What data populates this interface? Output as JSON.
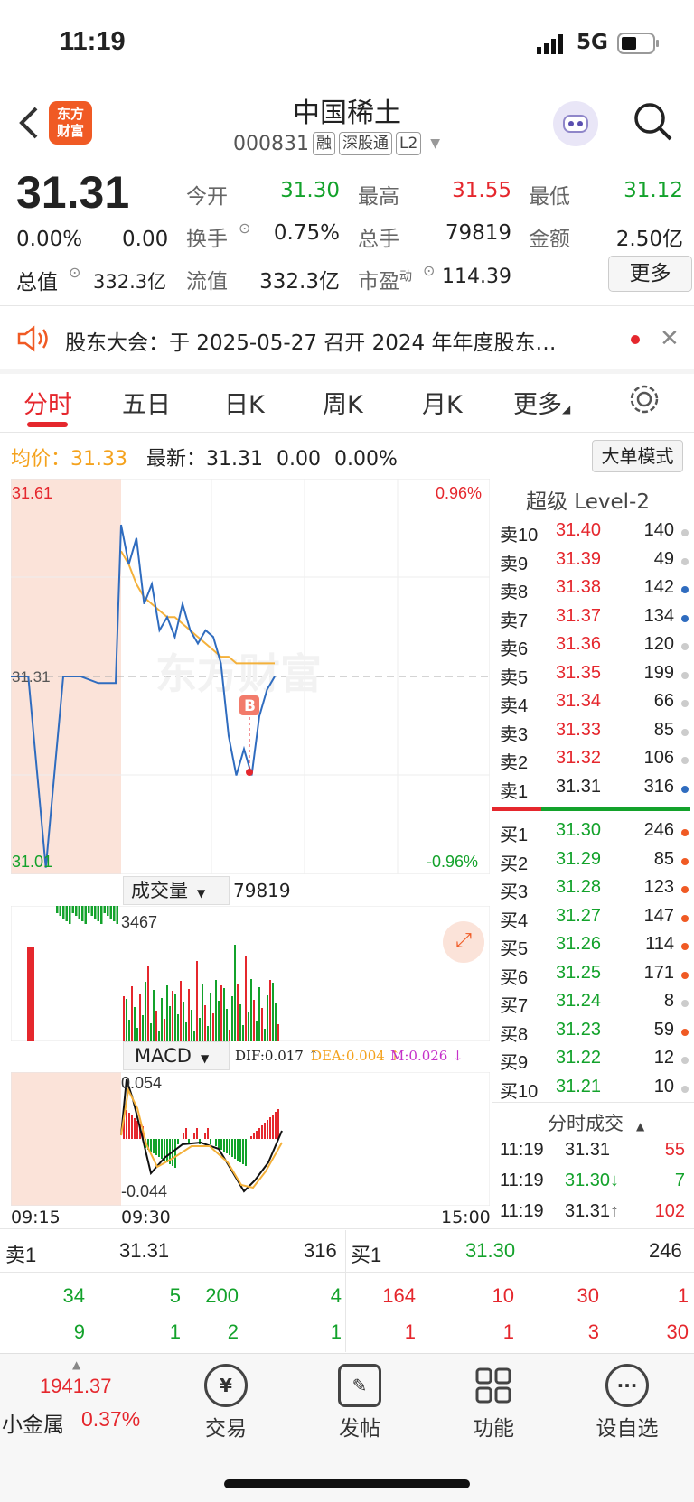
{
  "status_bar": {
    "time": "11:19",
    "network": "5G"
  },
  "header": {
    "logo_line1": "东方",
    "logo_line2": "财富",
    "title": "中国稀土",
    "code": "000831",
    "tags": [
      "融",
      "深股通",
      "L2"
    ]
  },
  "quote": {
    "price": "31.31",
    "change_pct": "0.00%",
    "change": "0.00",
    "open_label": "今开",
    "open": "31.30",
    "high_label": "最高",
    "high": "31.55",
    "low_label": "最低",
    "low": "31.12",
    "turnover_label": "换手",
    "turnover": "0.75%",
    "volume_label": "总手",
    "volume": "79819",
    "amount_label": "金额",
    "amount": "2.50亿",
    "mcap_label": "总值",
    "mcap": "332.3亿",
    "float_label": "流值",
    "float": "332.3亿",
    "pe_label": "市盈",
    "pe_sup": "动",
    "pe": "114.39",
    "more_label": "更多"
  },
  "notice": {
    "text": "股东大会：于 2025-05-27 召开 2024 年年度股东…"
  },
  "tabs": [
    "分时",
    "五日",
    "日K",
    "周K",
    "月K",
    "更多"
  ],
  "avg": {
    "label": "均价：",
    "value": "31.33",
    "latest_label": "最新：",
    "latest": "31.31",
    "change": "0.00",
    "pct": "0.00%",
    "mode_btn": "大单模式"
  },
  "chart_labels": {
    "ymax": "31.61",
    "ymin": "31.01",
    "pmax": "0.96%",
    "pmin": "-0.96%",
    "ymid": "31.31",
    "vol_label": "成交量",
    "vol_value": "79819",
    "vol_max": "3467",
    "macd_label": "MACD",
    "dif": "DIF:0.017 ↑",
    "dea": "DEA:0.004 ↑",
    "m": "M:0.026 ↓",
    "macd_max": "0.054",
    "macd_min": "-0.044",
    "t0": "09:15",
    "t1": "09:30",
    "t2": "15:00",
    "b_marker": "B"
  },
  "chart_data": {
    "type": "line",
    "x_range": [
      "09:15",
      "15:00"
    ],
    "y_range": [
      31.01,
      31.61
    ],
    "series": [
      {
        "values": [
          31.31,
          31.31,
          31.02,
          31.31,
          31.31,
          31.3,
          31.3,
          31.54,
          31.48,
          31.52,
          31.42,
          31.45,
          31.38,
          31.4,
          31.37,
          31.42,
          31.38,
          31.36,
          31.38,
          31.37,
          31.33,
          31.22,
          31.16,
          31.2,
          31.16,
          31.25,
          31.29,
          31.31
        ]
      },
      {
        "values": [
          31.31,
          31.31,
          31.31,
          31.31,
          31.31,
          31.31,
          31.31,
          31.5,
          31.48,
          31.45,
          31.43,
          31.42,
          31.41,
          31.4,
          31.4,
          31.39,
          31.38,
          31.37,
          31.36,
          31.35,
          31.34,
          31.34,
          31.33,
          31.33,
          31.33,
          31.33,
          31.33,
          31.33
        ]
      }
    ]
  },
  "orderbook": {
    "title": "超级 Level-2",
    "asks": [
      {
        "label": "卖10",
        "price": "31.40",
        "vol": "140"
      },
      {
        "label": "卖9",
        "price": "31.39",
        "vol": "49"
      },
      {
        "label": "卖8",
        "price": "31.38",
        "vol": "142"
      },
      {
        "label": "卖7",
        "price": "31.37",
        "vol": "134"
      },
      {
        "label": "卖6",
        "price": "31.36",
        "vol": "120"
      },
      {
        "label": "卖5",
        "price": "31.35",
        "vol": "199"
      },
      {
        "label": "卖4",
        "price": "31.34",
        "vol": "66"
      },
      {
        "label": "卖3",
        "price": "31.33",
        "vol": "85"
      },
      {
        "label": "卖2",
        "price": "31.32",
        "vol": "106"
      },
      {
        "label": "卖1",
        "price": "31.31",
        "vol": "316"
      }
    ],
    "bids": [
      {
        "label": "买1",
        "price": "31.30",
        "vol": "246"
      },
      {
        "label": "买2",
        "price": "31.29",
        "vol": "85"
      },
      {
        "label": "买3",
        "price": "31.28",
        "vol": "123"
      },
      {
        "label": "买4",
        "price": "31.27",
        "vol": "147"
      },
      {
        "label": "买5",
        "price": "31.26",
        "vol": "114"
      },
      {
        "label": "买6",
        "price": "31.25",
        "vol": "171"
      },
      {
        "label": "买7",
        "price": "31.24",
        "vol": "8"
      },
      {
        "label": "买8",
        "price": "31.23",
        "vol": "59"
      },
      {
        "label": "买9",
        "price": "31.22",
        "vol": "12"
      },
      {
        "label": "买10",
        "price": "31.21",
        "vol": "10"
      }
    ],
    "trades_title": "分时成交",
    "trades": [
      {
        "time": "11:19",
        "price": "31.31",
        "vol": "55"
      },
      {
        "time": "11:19",
        "price": "31.30↓",
        "vol": "7"
      },
      {
        "time": "11:19",
        "price": "31.31↑",
        "vol": "102"
      }
    ]
  },
  "bottom": {
    "sell_label": "卖1",
    "sell_price": "31.31",
    "sell_vol": "316",
    "buy_label": "买1",
    "buy_price": "31.30",
    "buy_vol": "246",
    "sell_q1": [
      "34",
      "5",
      "200",
      "4"
    ],
    "sell_q2": [
      "9",
      "1",
      "2",
      "1"
    ],
    "buy_q1": [
      "164",
      "10",
      "30",
      "1"
    ],
    "buy_q2": [
      "1",
      "1",
      "3",
      "30"
    ]
  },
  "nav": {
    "index_value": "1941.37",
    "index_name": "小金属",
    "index_pct": "0.37%",
    "trade": "交易",
    "post": "发帖",
    "func": "功能",
    "watch": "设自选"
  }
}
